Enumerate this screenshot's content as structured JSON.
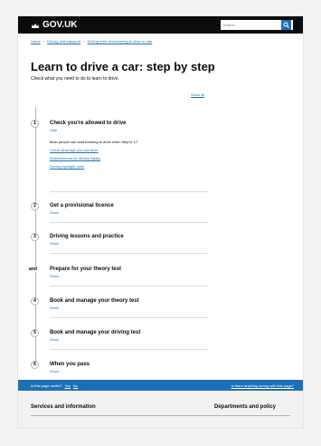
{
  "header": {
    "logo_text": "GOV.UK",
    "search_placeholder": "Search"
  },
  "breadcrumb": [
    "Home",
    "Driving and transport",
    "Driving tests and learning to drive or ride"
  ],
  "title": "Learn to drive a car: step by step",
  "lede": "Check what you need to do to learn to drive.",
  "show_all": "Show all",
  "steps": [
    {
      "marker": "1",
      "title": "Check you're allowed to drive",
      "toggle": "Hide",
      "panel_text": "Most people can start learning to drive when they're 17.",
      "links": [
        "Check what age you can drive",
        "Requirements for driving legally",
        "Driving eyesight rules"
      ]
    },
    {
      "marker": "2",
      "title": "Get a provisional licence",
      "toggle": "Show"
    },
    {
      "marker": "3",
      "title": "Driving lessons and practice",
      "toggle": "Show"
    },
    {
      "marker": "and",
      "title": "Prepare for your theory test",
      "toggle": "Show"
    },
    {
      "marker": "4",
      "title": "Book and manage your theory test",
      "toggle": "Show"
    },
    {
      "marker": "5",
      "title": "Book and manage your driving test",
      "toggle": "Show"
    },
    {
      "marker": "6",
      "title": "When you pass",
      "toggle": "Show"
    }
  ],
  "feedback": {
    "question": "Is this page useful?",
    "yes": "Yes",
    "no": "No",
    "problem": "Is there anything wrong with this page?"
  },
  "footer": {
    "col1": "Services and information",
    "col2": "Departments and policy"
  },
  "colors": {
    "link": "#1d70b8",
    "header_bg": "#0b0c0c",
    "footer_bg": "#f3f2f1"
  }
}
